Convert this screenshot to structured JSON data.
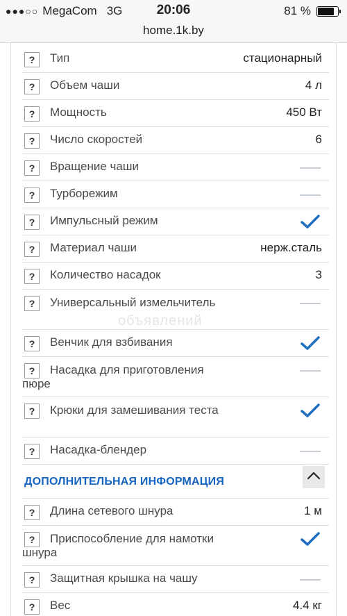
{
  "status_bar": {
    "signal": "●●●○○",
    "carrier": "MegaCom",
    "network": "3G",
    "time": "20:06",
    "battery_text": "81 %",
    "battery_level": 0.81
  },
  "browser": {
    "url": "home.1k.by"
  },
  "help_label": "?",
  "watermark": "объявлений",
  "specs": [
    {
      "label": "Тип",
      "value": "стационарный",
      "kind": "text"
    },
    {
      "label": "Объем чаши",
      "value": "4 л",
      "kind": "text"
    },
    {
      "label": "Мощность",
      "value": "450 Вт",
      "kind": "text"
    },
    {
      "label": "Число скоростей",
      "value": "6",
      "kind": "text"
    },
    {
      "label": "Вращение чаши",
      "value": "",
      "kind": "no"
    },
    {
      "label": "Турборежим",
      "value": "",
      "kind": "no"
    },
    {
      "label": "Импульсный режим",
      "value": "",
      "kind": "yes"
    },
    {
      "label": "Материал чаши",
      "value": "нерж.сталь",
      "kind": "text"
    },
    {
      "label": "Количество насадок",
      "value": "3",
      "kind": "text"
    },
    {
      "label": "Универсальный измельчитель",
      "value": "",
      "kind": "no"
    },
    {
      "label": "Венчик для взбивания",
      "value": "",
      "kind": "yes"
    },
    {
      "label": "Насадка для приготовления пюре",
      "value": "",
      "kind": "no"
    },
    {
      "label": "Крюки для замешивания теста",
      "value": "",
      "kind": "yes"
    },
    {
      "label": "Насадка-блендер",
      "value": "",
      "kind": "no"
    }
  ],
  "section": {
    "title": "ДОПОЛНИТЕЛЬНАЯ ИНФОРМАЦИЯ"
  },
  "extra_specs": [
    {
      "label": "Длина сетевого шнура",
      "value": "1 м",
      "kind": "text"
    },
    {
      "label": "Приспособление для намотки шнура",
      "value": "",
      "kind": "yes"
    },
    {
      "label": "Защитная крышка на чашу",
      "value": "",
      "kind": "no"
    },
    {
      "label": "Вес",
      "value": "4.4 кг",
      "kind": "text"
    }
  ],
  "colors": {
    "accent": "#1565c0",
    "check": "#1e6fc0",
    "dash": "#c8cfd6",
    "section_title": "#1565c0"
  }
}
